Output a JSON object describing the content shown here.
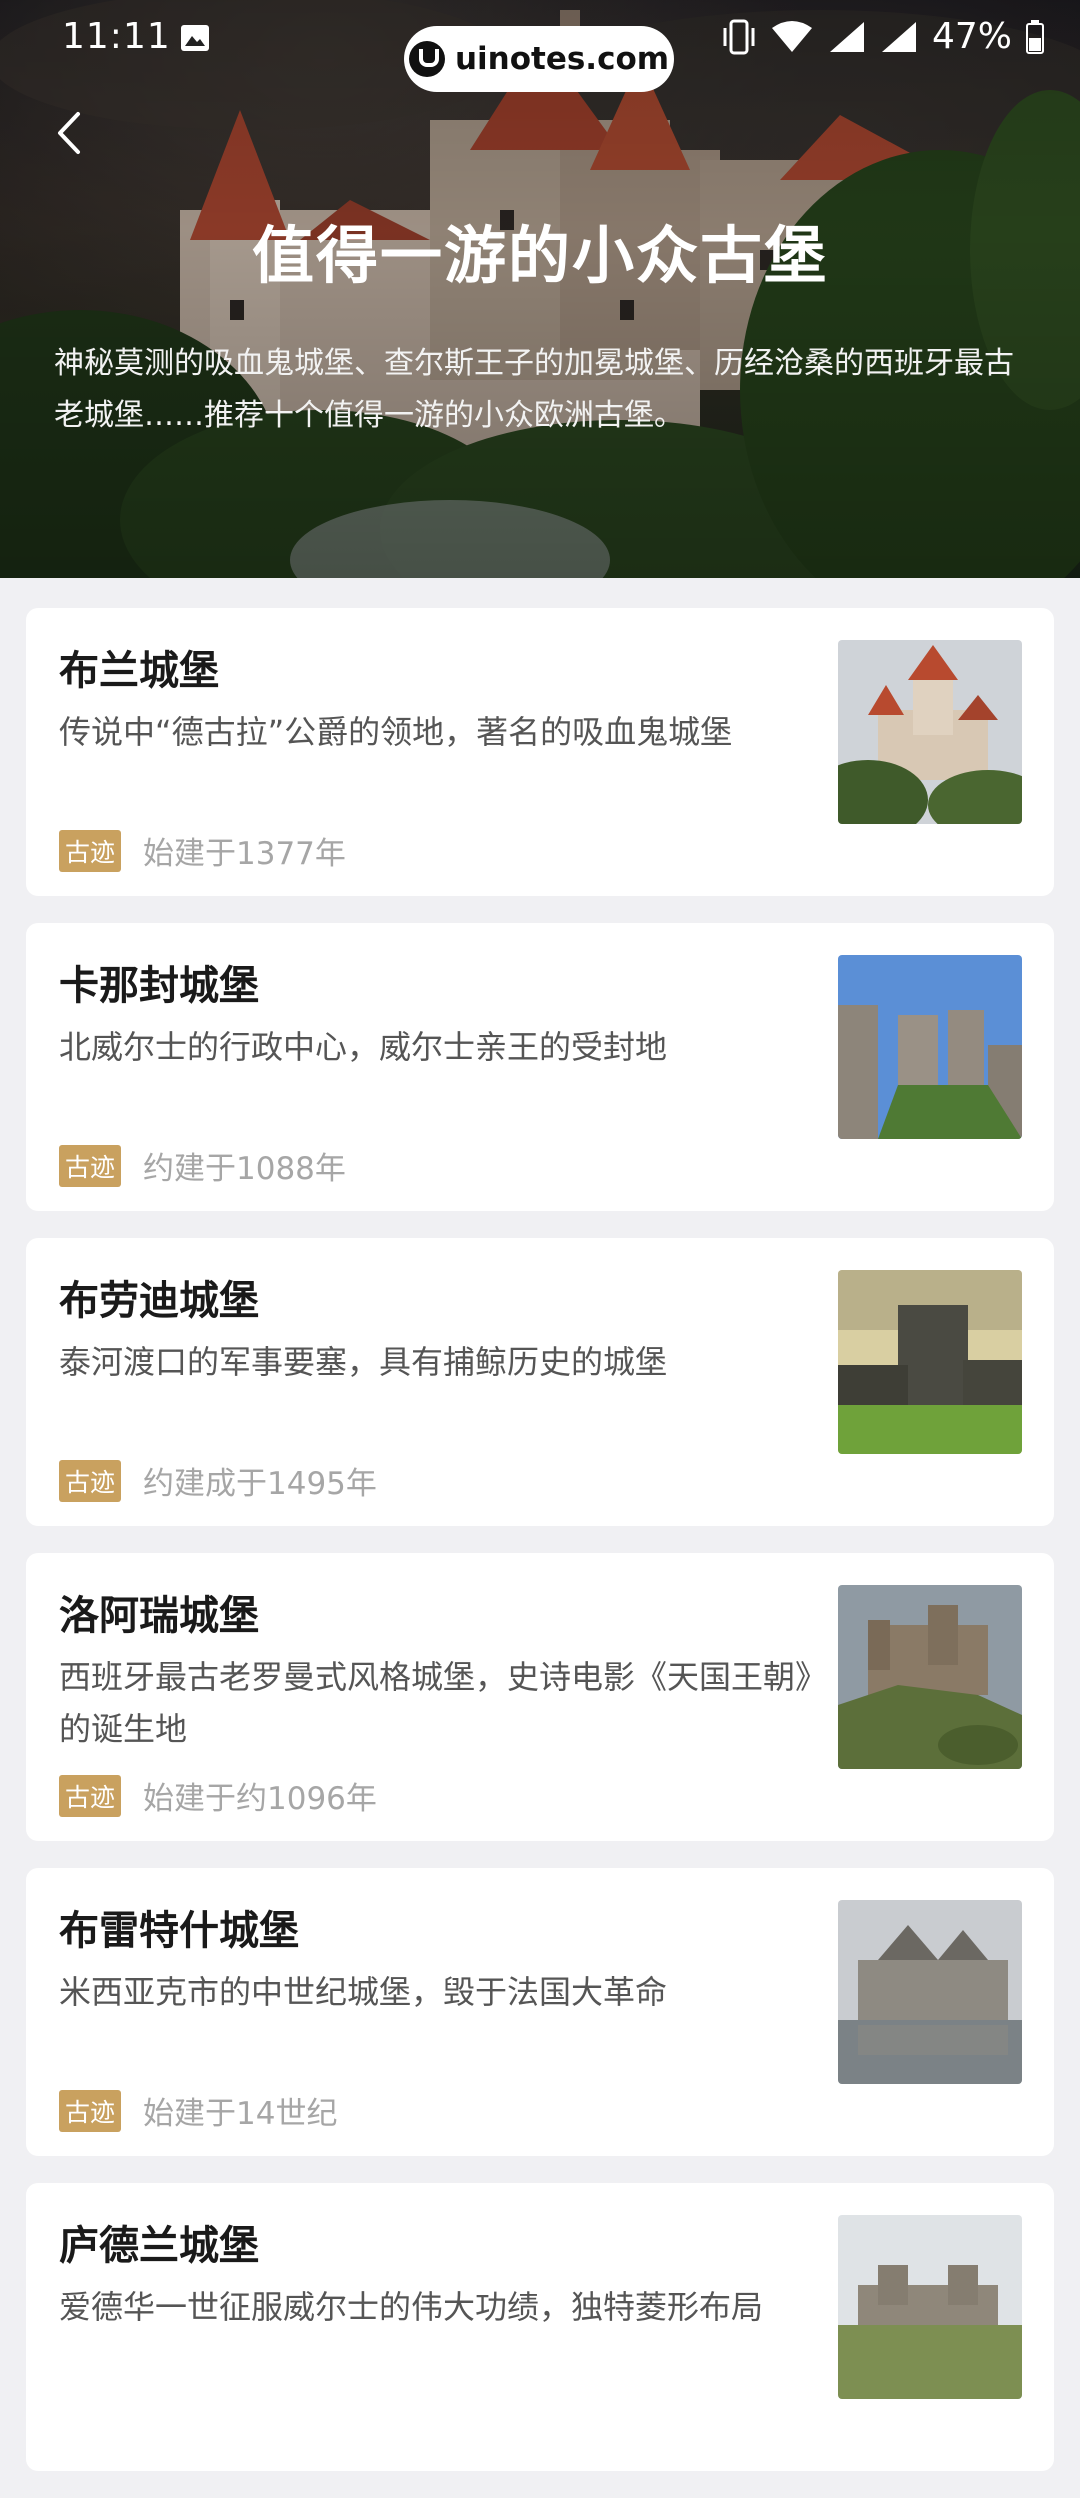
{
  "status_bar": {
    "time": "11:11",
    "battery": "47%",
    "watermark": "uinotes.com"
  },
  "header": {
    "title": "值得一游的小众古堡",
    "description": "神秘莫测的吸血鬼城堡、查尔斯王子的加冕城堡、历经沧桑的西班牙最古老城堡……推荐十个值得一游的小众欧洲古堡。"
  },
  "castles": [
    {
      "name": "布兰城堡",
      "desc": "传说中“德古拉”公爵的领地，著名的吸血鬼城堡",
      "tag": "古迹",
      "date": "始建于1377年"
    },
    {
      "name": "卡那封城堡",
      "desc": "北威尔士的行政中心，威尔士亲王的受封地",
      "tag": "古迹",
      "date": "约建于1088年"
    },
    {
      "name": "布劳迪城堡",
      "desc": "泰河渡口的军事要塞，具有捕鲸历史的城堡",
      "tag": "古迹",
      "date": "约建成于1495年"
    },
    {
      "name": "洛阿瑞城堡",
      "desc": "西班牙最古老罗曼式风格城堡，史诗电影《天国王朝》的诞生地",
      "tag": "古迹",
      "date": "始建于约1096年"
    },
    {
      "name": "布雷特什城堡",
      "desc": "米西亚克市的中世纪城堡，毁于法国大革命",
      "tag": "古迹",
      "date": "始建于14世纪"
    },
    {
      "name": "庐德兰城堡",
      "desc": "爱德华一世征服威尔士的伟大功绩，独特菱形布局",
      "tag": "",
      "date": ""
    }
  ]
}
